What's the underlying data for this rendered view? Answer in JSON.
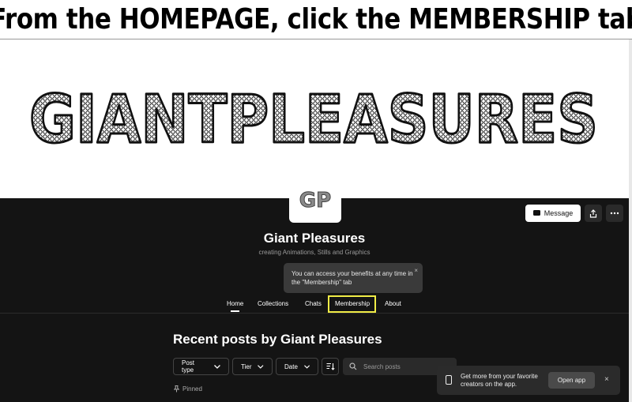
{
  "instruction_banner": "From the HOMEPAGE, click the MEMBERSHIP tab",
  "hero": {
    "logo_text": "GIANTPLEASURES"
  },
  "avatar": {
    "initials": "GP"
  },
  "header": {
    "message_label": "Message",
    "share_icon": "share-icon",
    "more_icon": "more-icon"
  },
  "profile": {
    "name": "Giant Pleasures",
    "tagline": "creating Animations, Stills and Graphics"
  },
  "tooltip": {
    "text": "You can access your benefits at any time in the \"Membership\" tab",
    "close": "×"
  },
  "nav": {
    "tabs": [
      {
        "label": "Home"
      },
      {
        "label": "Collections"
      },
      {
        "label": "Chats"
      },
      {
        "label": "Membership"
      },
      {
        "label": "About"
      }
    ]
  },
  "posts": {
    "heading": "Recent posts by Giant Pleasures",
    "filters": {
      "post_type": "Post type",
      "tier": "Tier",
      "date": "Date"
    },
    "search_placeholder": "Search posts",
    "pinned_label": "Pinned"
  },
  "toast": {
    "text": "Get more from your favorite creators on the app.",
    "button": "Open app",
    "close": "×"
  },
  "colors": {
    "background_dark": "#141414",
    "highlight": "#f0ec46",
    "white": "#ffffff"
  }
}
